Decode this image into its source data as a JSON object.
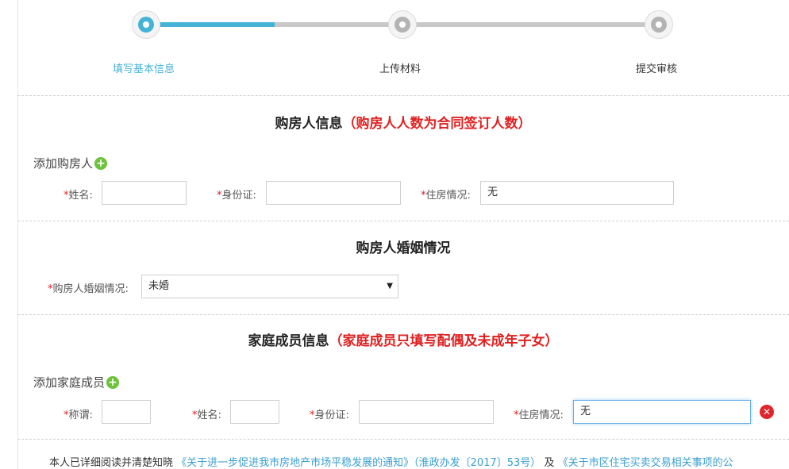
{
  "steps": [
    {
      "label": "填写基本信息",
      "state": "active"
    },
    {
      "label": "上传材料",
      "state": "todo"
    },
    {
      "label": "提交审核",
      "state": "todo"
    }
  ],
  "buyer_section": {
    "title": "购房人信息",
    "note": "（购房人人数为合同签订人数）",
    "add_label": "添加购房人",
    "fields": {
      "name_label": "姓名:",
      "id_label": "身份证:",
      "housing_label": "住房情况:",
      "name_value": "",
      "id_value": "",
      "housing_value": "无"
    }
  },
  "marriage_section": {
    "title": "购房人婚姻情况",
    "label": "购房人婚姻情况:",
    "selected": "未婚"
  },
  "family_section": {
    "title": "家庭成员信息",
    "note": "（家庭成员只填写配偶及未成年子女）",
    "add_label": "添加家庭成员",
    "fields": {
      "relation_label": "称谓:",
      "name_label": "姓名:",
      "id_label": "身份证:",
      "housing_label": "住房情况:",
      "relation_value": "",
      "name_value": "",
      "id_value": "",
      "housing_value": "无"
    }
  },
  "required_mark": "*",
  "notice": {
    "prefix": "本人已详细阅读并清楚知晓",
    "link1": "《关于进一步促进我市房地产市场平稳发展的通知》（淮政办发〔2017〕53号）",
    "conj": "及",
    "link2": "《关于市区住宅买卖交易相关事项的公"
  },
  "colors": {
    "accent": "#45b3d6",
    "required": "#e02020",
    "add_icon": "#6cc23a",
    "remove_icon": "#e0252b"
  }
}
